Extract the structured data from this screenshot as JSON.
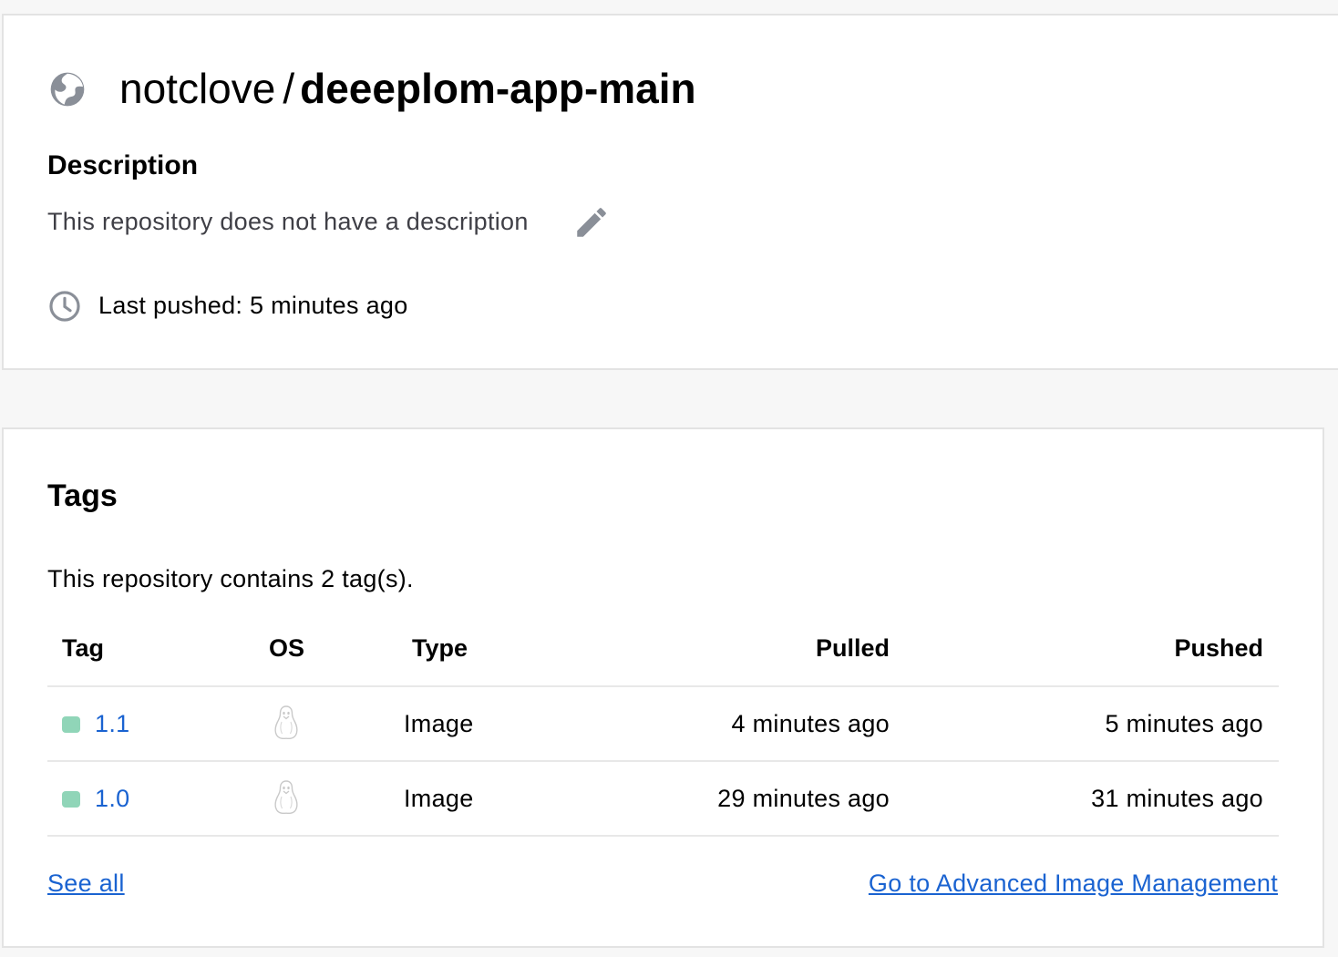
{
  "repository": {
    "namespace": "notclove",
    "separator": "/",
    "name": "deeeplom-app-main",
    "visibility_icon": "globe-icon",
    "description_heading": "Description",
    "description_text": "This repository does not have a description",
    "edit_icon": "pencil-icon",
    "last_pushed_icon": "clock-icon",
    "last_pushed": "Last pushed: 5 minutes ago"
  },
  "tags_section": {
    "heading": "Tags",
    "summary": "This repository contains 2 tag(s).",
    "columns": {
      "tag": "Tag",
      "os": "OS",
      "type": "Type",
      "pulled": "Pulled",
      "pushed": "Pushed"
    },
    "rows": [
      {
        "tag": "1.1",
        "os_icon": "linux-penguin-icon",
        "type": "Image",
        "pulled": "4 minutes ago",
        "pushed": "5 minutes ago"
      },
      {
        "tag": "1.0",
        "os_icon": "linux-penguin-icon",
        "type": "Image",
        "pulled": "29 minutes ago",
        "pushed": "31 minutes ago"
      }
    ],
    "see_all_label": "See all",
    "advanced_link_label": "Go to Advanced Image Management"
  },
  "colors": {
    "link": "#1a63d1",
    "status_dot": "#90d5b8",
    "icon_gray": "#8a8f98",
    "page_background": "#f7f7f7"
  }
}
